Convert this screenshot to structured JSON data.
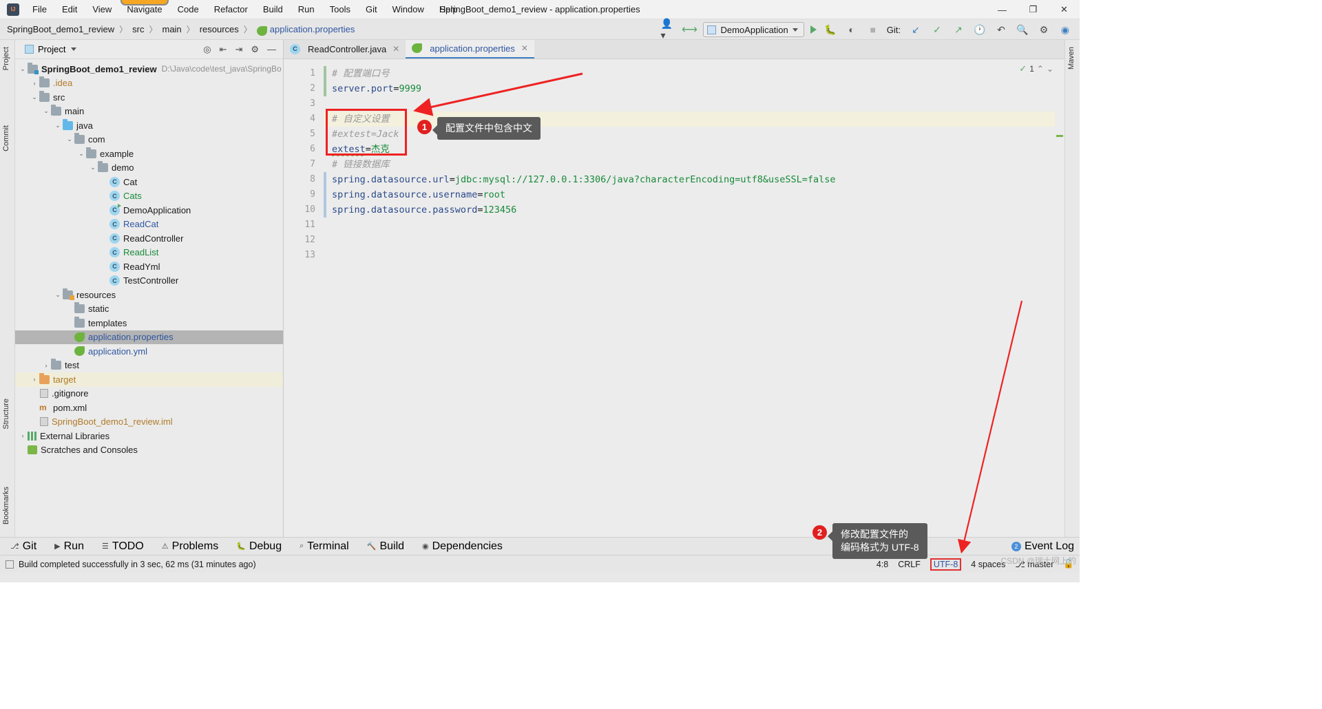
{
  "window": {
    "title": "SpringBoot_demo1_review - application.properties",
    "minimize": "—",
    "maximize": "❐",
    "close": "✕",
    "logo_text": "IJ"
  },
  "menu": {
    "items": [
      "File",
      "Edit",
      "View",
      "Navigate",
      "Code",
      "Refactor",
      "Build",
      "Run",
      "Tools",
      "Git",
      "Window",
      "Help"
    ]
  },
  "breadcrumb": {
    "items": [
      "SpringBoot_demo1_review",
      "src",
      "main",
      "resources",
      "application.properties"
    ],
    "separator": "〉"
  },
  "toolbar": {
    "run_config": "DemoApplication",
    "git_label": "Git:",
    "icons": [
      "user-icon",
      "hammer-icon",
      "run-icon",
      "debug-icon",
      "coverage-icon",
      "stop-icon",
      "update-project-icon",
      "commit-icon",
      "push-icon",
      "history-icon",
      "rollback-icon",
      "search-icon",
      "settings-icon",
      "ide-assist-icon"
    ]
  },
  "left_tool_tabs": [
    "Project",
    "Commit",
    "Structure",
    "Bookmarks"
  ],
  "right_tool_tabs": [
    "Maven"
  ],
  "project_panel": {
    "title": "Project",
    "tools": [
      "locate-icon",
      "collapse-all-icon",
      "expand-icon",
      "settings-icon",
      "hide-icon"
    ],
    "tree": [
      {
        "depth": 0,
        "arrow": "v",
        "icon": "folder-module",
        "label": "SpringBoot_demo1_review",
        "path": "D:\\Java\\code\\test_java\\SpringBo",
        "bold": true
      },
      {
        "depth": 1,
        "arrow": ">",
        "icon": "folder",
        "label": ".idea",
        "color": "orange"
      },
      {
        "depth": 1,
        "arrow": "v",
        "icon": "folder",
        "label": "src"
      },
      {
        "depth": 2,
        "arrow": "v",
        "icon": "folder",
        "label": "main"
      },
      {
        "depth": 3,
        "arrow": "v",
        "icon": "folder-source",
        "label": "java"
      },
      {
        "depth": 4,
        "arrow": "v",
        "icon": "package",
        "label": "com"
      },
      {
        "depth": 5,
        "arrow": "v",
        "icon": "package",
        "label": "example"
      },
      {
        "depth": 6,
        "arrow": "v",
        "icon": "package",
        "label": "demo"
      },
      {
        "depth": 7,
        "arrow": "",
        "icon": "class",
        "label": "Cat"
      },
      {
        "depth": 7,
        "arrow": "",
        "icon": "class",
        "label": "Cats",
        "color": "green"
      },
      {
        "depth": 7,
        "arrow": "",
        "icon": "class-runnable",
        "label": "DemoApplication"
      },
      {
        "depth": 7,
        "arrow": "",
        "icon": "class",
        "label": "ReadCat",
        "color": "blue"
      },
      {
        "depth": 7,
        "arrow": "",
        "icon": "class",
        "label": "ReadController"
      },
      {
        "depth": 7,
        "arrow": "",
        "icon": "class",
        "label": "ReadList",
        "color": "green"
      },
      {
        "depth": 7,
        "arrow": "",
        "icon": "class",
        "label": "ReadYml"
      },
      {
        "depth": 7,
        "arrow": "",
        "icon": "class",
        "label": "TestController"
      },
      {
        "depth": 3,
        "arrow": "v",
        "icon": "folder-resource",
        "label": "resources"
      },
      {
        "depth": 4,
        "arrow": "",
        "icon": "folder",
        "label": "static"
      },
      {
        "depth": 4,
        "arrow": "",
        "icon": "folder",
        "label": "templates"
      },
      {
        "depth": 4,
        "arrow": "",
        "icon": "spring-file",
        "label": "application.properties",
        "color": "blue",
        "selected": true
      },
      {
        "depth": 4,
        "arrow": "",
        "icon": "spring-file",
        "label": "application.yml",
        "color": "blue"
      },
      {
        "depth": 2,
        "arrow": ">",
        "icon": "folder",
        "label": "test"
      },
      {
        "depth": 1,
        "arrow": ">",
        "icon": "folder-target",
        "label": "target",
        "color": "orange",
        "highlight": true
      },
      {
        "depth": 1,
        "arrow": "",
        "icon": "gitignore-file",
        "label": ".gitignore"
      },
      {
        "depth": 1,
        "arrow": "",
        "icon": "xml-file",
        "label": "pom.xml"
      },
      {
        "depth": 1,
        "arrow": "",
        "icon": "iml-file",
        "label": "SpringBoot_demo1_review.iml",
        "color": "orange"
      },
      {
        "depth": 0,
        "arrow": ">",
        "icon": "library",
        "label": "External Libraries"
      },
      {
        "depth": 0,
        "arrow": "",
        "icon": "scratches",
        "label": "Scratches and Consoles"
      }
    ]
  },
  "editor": {
    "tabs": [
      {
        "label": "ReadController.java",
        "icon": "java-class-icon",
        "active": false
      },
      {
        "label": "application.properties",
        "icon": "spring-file-icon",
        "active": true
      }
    ],
    "inspection_count": "1",
    "line_numbers": [
      "1",
      "2",
      "3",
      "4",
      "5",
      "6",
      "7",
      "8",
      "9",
      "10",
      "11",
      "12",
      "13"
    ],
    "lines": [
      {
        "n": 1,
        "type": "comment",
        "text": "# 配置端口号"
      },
      {
        "n": 2,
        "type": "kv",
        "key": "server.port",
        "value": "9999"
      },
      {
        "n": 3,
        "type": "blank",
        "text": ""
      },
      {
        "n": 4,
        "type": "comment",
        "text": "# 自定义设置",
        "highlight": true
      },
      {
        "n": 5,
        "type": "comment",
        "text": "#extest=Jack"
      },
      {
        "n": 6,
        "type": "kv",
        "key": "extest",
        "value": "杰克",
        "squiggle": true
      },
      {
        "n": 7,
        "type": "comment",
        "text": "# 链接数据库"
      },
      {
        "n": 8,
        "type": "kv",
        "key": "spring.datasource.url",
        "value": "jdbc:mysql://127.0.0.1:3306/java?characterEncoding=utf8&useSSL=false"
      },
      {
        "n": 9,
        "type": "kv",
        "key": "spring.datasource.username",
        "value": "root"
      },
      {
        "n": 10,
        "type": "kv",
        "key": "spring.datasource.password",
        "value": "123456"
      },
      {
        "n": 11,
        "type": "blank",
        "text": ""
      },
      {
        "n": 12,
        "type": "blank",
        "text": ""
      },
      {
        "n": 13,
        "type": "blank",
        "text": ""
      }
    ]
  },
  "annotations": [
    {
      "number": "1",
      "text": "配置文件中包含中文"
    },
    {
      "number": "2",
      "text": "修改配置文件的\n编码格式为 UTF-8"
    }
  ],
  "bottom_tabs": [
    {
      "label": "Git",
      "icon": "git-icon"
    },
    {
      "label": "Run",
      "icon": "run-icon"
    },
    {
      "label": "TODO",
      "icon": "todo-icon"
    },
    {
      "label": "Problems",
      "icon": "problems-icon"
    },
    {
      "label": "Debug",
      "icon": "debug-icon"
    },
    {
      "label": "Terminal",
      "icon": "terminal-icon"
    },
    {
      "label": "Build",
      "icon": "build-icon"
    },
    {
      "label": "Dependencies",
      "icon": "dependencies-icon"
    }
  ],
  "status": {
    "message": "Build completed successfully in 3 sec, 62 ms (31 minutes ago)",
    "caret": "4:8",
    "line_sep": "CRLF",
    "encoding": "UTF-8",
    "indent": "4 spaces",
    "branch": "master",
    "event_log": "Event Log",
    "event_count": "2",
    "lock_icon": "lock-icon"
  },
  "watermark": "CSDN @瑞士网上的",
  "colors": {
    "accent_red": "#ee2222",
    "tab_active_underline": "#3d7fc1",
    "string_green": "#178a3a",
    "key_blue": "#2b4a8a",
    "comment_gray": "#9a9a9a",
    "selection_gray": "#b4b4b4",
    "target_highlight": "#f0eeda"
  }
}
